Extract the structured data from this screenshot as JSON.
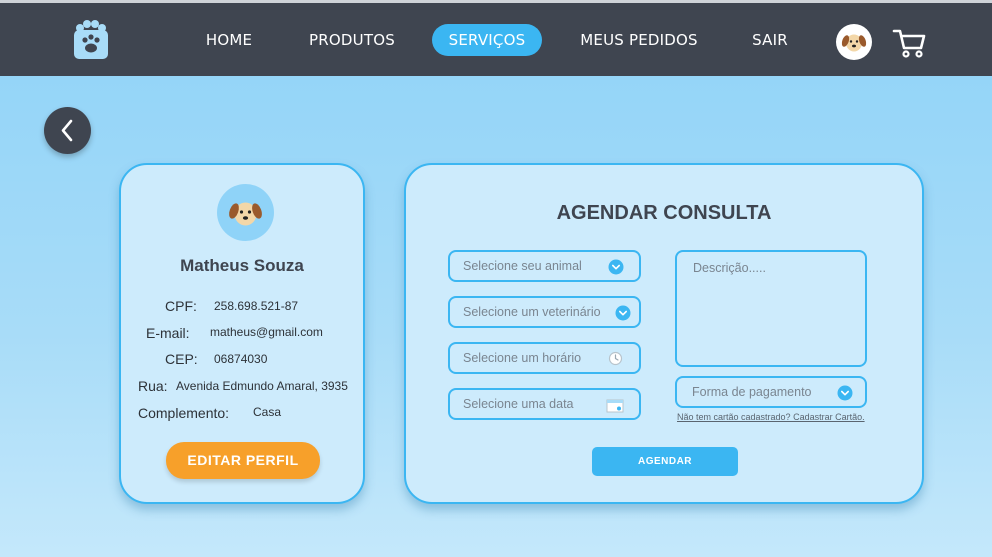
{
  "nav": {
    "items": [
      {
        "label": "HOME",
        "active": false
      },
      {
        "label": "PRODUTOS",
        "active": false
      },
      {
        "label": "SERVIÇOS",
        "active": true
      },
      {
        "label": "MEUS PEDIDOS",
        "active": false
      },
      {
        "label": "SAIR",
        "active": false
      }
    ],
    "avatar_icon": "dog-avatar-icon",
    "cart_icon": "cart-icon",
    "logo_icon": "paw-logo-icon"
  },
  "colors": {
    "navbar": "#3f4550",
    "accent": "#3bb6f2",
    "edit_button": "#f7a02a",
    "card_bg": "#cdebfc"
  },
  "profile": {
    "name": "Matheus Souza",
    "fields": [
      {
        "label": "CPF:",
        "value": "258.698.521-87"
      },
      {
        "label": "E-mail:",
        "value": "matheus@gmail.com"
      },
      {
        "label": "CEP:",
        "value": "06874030"
      },
      {
        "label": "Rua:",
        "value": "Avenida Edmundo Amaral, 3935"
      },
      {
        "label": "Complemento:",
        "value": "Casa"
      }
    ],
    "edit_label": "EDITAR PERFIL"
  },
  "form": {
    "title": "AGENDAR CONSULTA",
    "animal_placeholder": "Selecione seu animal",
    "vet_placeholder": "Selecione um veterinário",
    "time_placeholder": "Selecione um horário",
    "date_placeholder": "Selecione uma data",
    "description_placeholder": "Descrição.....",
    "payment_placeholder": "Forma de pagamento",
    "card_link": "Não tem cartão cadastrado? Cadastrar Cartão.",
    "submit_label": "AGENDAR"
  }
}
